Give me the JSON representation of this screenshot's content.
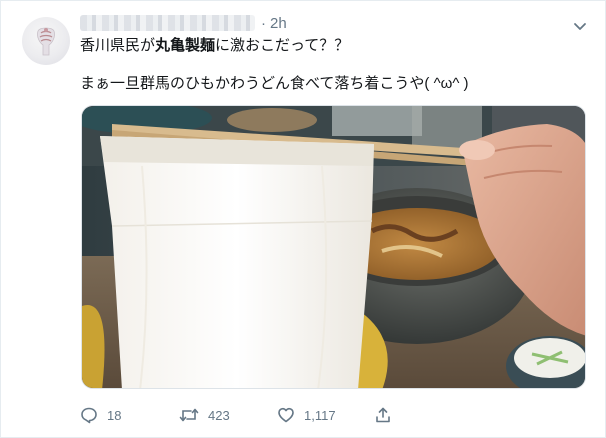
{
  "tweet": {
    "time": "2h",
    "separator": "·",
    "line1_prefix": "香川県民が",
    "line1_bold": "丸亀製麺",
    "line1_suffix": "に激おこだって？？",
    "line2": "まぁ一旦群馬のひもかわうどん食べて落ち着こうや( ^ω^ )"
  },
  "media": {
    "description_icon": "photo"
  },
  "actions": {
    "reply_count": "18",
    "retweet_count": "423",
    "like_count": "1,117"
  },
  "colors": {
    "text": "#14171a",
    "muted": "#657786",
    "border": "#e6ecf0"
  }
}
